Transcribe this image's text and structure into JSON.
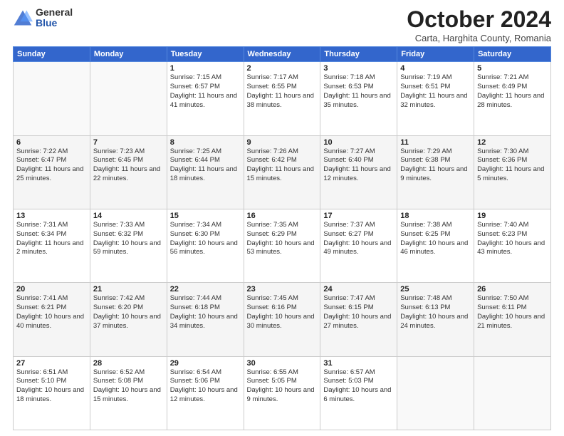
{
  "header": {
    "logo_general": "General",
    "logo_blue": "Blue",
    "month_title": "October 2024",
    "location": "Carta, Harghita County, Romania"
  },
  "days_of_week": [
    "Sunday",
    "Monday",
    "Tuesday",
    "Wednesday",
    "Thursday",
    "Friday",
    "Saturday"
  ],
  "weeks": [
    [
      {
        "day": "",
        "sunrise": "",
        "sunset": "",
        "daylight": ""
      },
      {
        "day": "",
        "sunrise": "",
        "sunset": "",
        "daylight": ""
      },
      {
        "day": "1",
        "sunrise": "Sunrise: 7:15 AM",
        "sunset": "Sunset: 6:57 PM",
        "daylight": "Daylight: 11 hours and 41 minutes."
      },
      {
        "day": "2",
        "sunrise": "Sunrise: 7:17 AM",
        "sunset": "Sunset: 6:55 PM",
        "daylight": "Daylight: 11 hours and 38 minutes."
      },
      {
        "day": "3",
        "sunrise": "Sunrise: 7:18 AM",
        "sunset": "Sunset: 6:53 PM",
        "daylight": "Daylight: 11 hours and 35 minutes."
      },
      {
        "day": "4",
        "sunrise": "Sunrise: 7:19 AM",
        "sunset": "Sunset: 6:51 PM",
        "daylight": "Daylight: 11 hours and 32 minutes."
      },
      {
        "day": "5",
        "sunrise": "Sunrise: 7:21 AM",
        "sunset": "Sunset: 6:49 PM",
        "daylight": "Daylight: 11 hours and 28 minutes."
      }
    ],
    [
      {
        "day": "6",
        "sunrise": "Sunrise: 7:22 AM",
        "sunset": "Sunset: 6:47 PM",
        "daylight": "Daylight: 11 hours and 25 minutes."
      },
      {
        "day": "7",
        "sunrise": "Sunrise: 7:23 AM",
        "sunset": "Sunset: 6:45 PM",
        "daylight": "Daylight: 11 hours and 22 minutes."
      },
      {
        "day": "8",
        "sunrise": "Sunrise: 7:25 AM",
        "sunset": "Sunset: 6:44 PM",
        "daylight": "Daylight: 11 hours and 18 minutes."
      },
      {
        "day": "9",
        "sunrise": "Sunrise: 7:26 AM",
        "sunset": "Sunset: 6:42 PM",
        "daylight": "Daylight: 11 hours and 15 minutes."
      },
      {
        "day": "10",
        "sunrise": "Sunrise: 7:27 AM",
        "sunset": "Sunset: 6:40 PM",
        "daylight": "Daylight: 11 hours and 12 minutes."
      },
      {
        "day": "11",
        "sunrise": "Sunrise: 7:29 AM",
        "sunset": "Sunset: 6:38 PM",
        "daylight": "Daylight: 11 hours and 9 minutes."
      },
      {
        "day": "12",
        "sunrise": "Sunrise: 7:30 AM",
        "sunset": "Sunset: 6:36 PM",
        "daylight": "Daylight: 11 hours and 5 minutes."
      }
    ],
    [
      {
        "day": "13",
        "sunrise": "Sunrise: 7:31 AM",
        "sunset": "Sunset: 6:34 PM",
        "daylight": "Daylight: 11 hours and 2 minutes."
      },
      {
        "day": "14",
        "sunrise": "Sunrise: 7:33 AM",
        "sunset": "Sunset: 6:32 PM",
        "daylight": "Daylight: 10 hours and 59 minutes."
      },
      {
        "day": "15",
        "sunrise": "Sunrise: 7:34 AM",
        "sunset": "Sunset: 6:30 PM",
        "daylight": "Daylight: 10 hours and 56 minutes."
      },
      {
        "day": "16",
        "sunrise": "Sunrise: 7:35 AM",
        "sunset": "Sunset: 6:29 PM",
        "daylight": "Daylight: 10 hours and 53 minutes."
      },
      {
        "day": "17",
        "sunrise": "Sunrise: 7:37 AM",
        "sunset": "Sunset: 6:27 PM",
        "daylight": "Daylight: 10 hours and 49 minutes."
      },
      {
        "day": "18",
        "sunrise": "Sunrise: 7:38 AM",
        "sunset": "Sunset: 6:25 PM",
        "daylight": "Daylight: 10 hours and 46 minutes."
      },
      {
        "day": "19",
        "sunrise": "Sunrise: 7:40 AM",
        "sunset": "Sunset: 6:23 PM",
        "daylight": "Daylight: 10 hours and 43 minutes."
      }
    ],
    [
      {
        "day": "20",
        "sunrise": "Sunrise: 7:41 AM",
        "sunset": "Sunset: 6:21 PM",
        "daylight": "Daylight: 10 hours and 40 minutes."
      },
      {
        "day": "21",
        "sunrise": "Sunrise: 7:42 AM",
        "sunset": "Sunset: 6:20 PM",
        "daylight": "Daylight: 10 hours and 37 minutes."
      },
      {
        "day": "22",
        "sunrise": "Sunrise: 7:44 AM",
        "sunset": "Sunset: 6:18 PM",
        "daylight": "Daylight: 10 hours and 34 minutes."
      },
      {
        "day": "23",
        "sunrise": "Sunrise: 7:45 AM",
        "sunset": "Sunset: 6:16 PM",
        "daylight": "Daylight: 10 hours and 30 minutes."
      },
      {
        "day": "24",
        "sunrise": "Sunrise: 7:47 AM",
        "sunset": "Sunset: 6:15 PM",
        "daylight": "Daylight: 10 hours and 27 minutes."
      },
      {
        "day": "25",
        "sunrise": "Sunrise: 7:48 AM",
        "sunset": "Sunset: 6:13 PM",
        "daylight": "Daylight: 10 hours and 24 minutes."
      },
      {
        "day": "26",
        "sunrise": "Sunrise: 7:50 AM",
        "sunset": "Sunset: 6:11 PM",
        "daylight": "Daylight: 10 hours and 21 minutes."
      }
    ],
    [
      {
        "day": "27",
        "sunrise": "Sunrise: 6:51 AM",
        "sunset": "Sunset: 5:10 PM",
        "daylight": "Daylight: 10 hours and 18 minutes."
      },
      {
        "day": "28",
        "sunrise": "Sunrise: 6:52 AM",
        "sunset": "Sunset: 5:08 PM",
        "daylight": "Daylight: 10 hours and 15 minutes."
      },
      {
        "day": "29",
        "sunrise": "Sunrise: 6:54 AM",
        "sunset": "Sunset: 5:06 PM",
        "daylight": "Daylight: 10 hours and 12 minutes."
      },
      {
        "day": "30",
        "sunrise": "Sunrise: 6:55 AM",
        "sunset": "Sunset: 5:05 PM",
        "daylight": "Daylight: 10 hours and 9 minutes."
      },
      {
        "day": "31",
        "sunrise": "Sunrise: 6:57 AM",
        "sunset": "Sunset: 5:03 PM",
        "daylight": "Daylight: 10 hours and 6 minutes."
      },
      {
        "day": "",
        "sunrise": "",
        "sunset": "",
        "daylight": ""
      },
      {
        "day": "",
        "sunrise": "",
        "sunset": "",
        "daylight": ""
      }
    ]
  ]
}
